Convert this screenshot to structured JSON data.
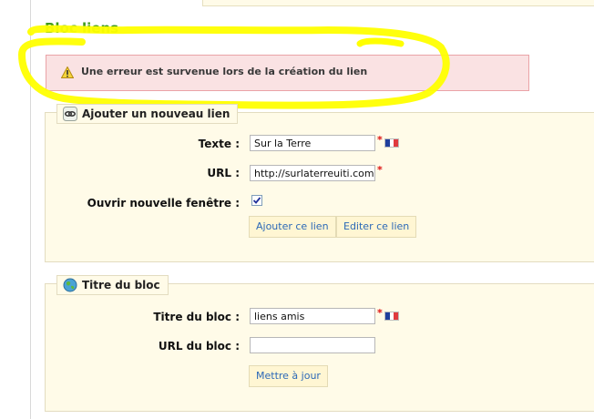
{
  "section": {
    "title": "Bloc liens"
  },
  "error": {
    "message": "Une erreur est survenue lors de la création du lien"
  },
  "add_link": {
    "legend": "Ajouter un nouveau lien",
    "fields": {
      "text": {
        "label": "Texte :",
        "value": "Sur la Terre"
      },
      "url": {
        "label": "URL :",
        "value": "http://surlaterreuiti.com"
      },
      "new_window": {
        "label": "Ouvrir nouvelle fenêtre :",
        "checked": true
      }
    },
    "buttons": {
      "add": "Ajouter ce lien",
      "edit": "Editer ce lien"
    }
  },
  "block_title": {
    "legend": "Titre du bloc",
    "fields": {
      "title": {
        "label": "Titre du bloc :",
        "value": "liens amis"
      },
      "url": {
        "label": "URL du bloc :",
        "value": ""
      }
    },
    "buttons": {
      "update": "Mettre à jour"
    }
  },
  "required_marker": "*",
  "colors": {
    "title": "#3e9a1b",
    "highlight": "#ffff00",
    "error_bg": "#fae2e3",
    "panel_bg": "#fffbe8",
    "button_text": "#2c69b7"
  }
}
